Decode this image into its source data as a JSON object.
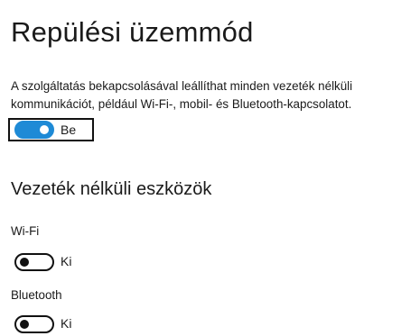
{
  "page": {
    "title": "Repülési üzemmód",
    "description_lines": [
      "A szolgáltatás bekapcsolásával leállíthat minden vezeték nélküli",
      "kommunikációt, például Wi-Fi-, mobil- és Bluetooth-kapcsolatot."
    ]
  },
  "airplane_toggle": {
    "state": "on",
    "label": "Be"
  },
  "wireless_section": {
    "heading": "Vezeték nélküli eszközök",
    "devices": [
      {
        "name": "Wi-Fi",
        "state": "off",
        "label": "Ki"
      },
      {
        "name": "Bluetooth",
        "state": "off",
        "label": "Ki"
      }
    ]
  },
  "colors": {
    "accent": "#1e8ad6",
    "text": "#1a1a1a",
    "background": "#ffffff"
  },
  "icons": []
}
